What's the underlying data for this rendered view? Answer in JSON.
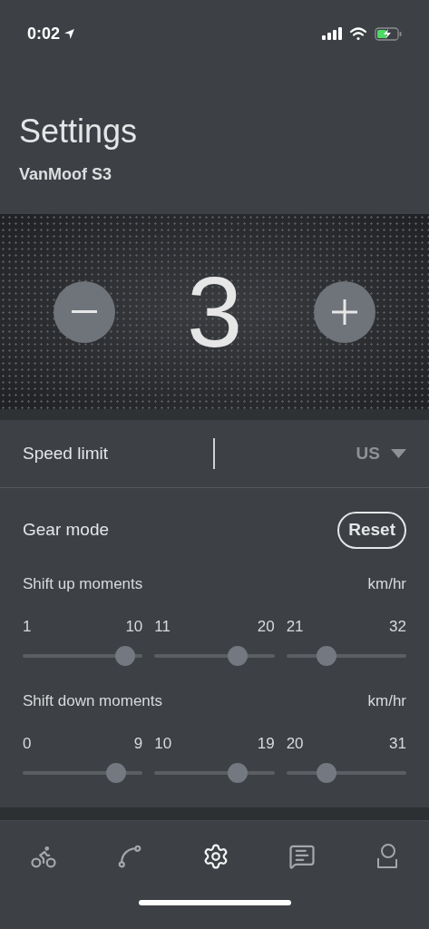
{
  "status_bar": {
    "time": "0:02"
  },
  "header": {
    "title": "Settings",
    "subtitle": "VanMoof S3"
  },
  "power_display": {
    "value": "3"
  },
  "speed_limit": {
    "label": "Speed limit",
    "region": "US"
  },
  "gear_mode": {
    "label": "Gear mode",
    "reset": "Reset",
    "groups": [
      {
        "label": "Shift up moments",
        "unit": "km/hr",
        "sliders": [
          {
            "min": "1",
            "max": "10",
            "level": 0.92
          },
          {
            "min": "11",
            "max": "20",
            "level": 0.73
          },
          {
            "min": "21",
            "max": "32",
            "level": 0.3
          }
        ]
      },
      {
        "label": "Shift down moments",
        "unit": "km/hr",
        "sliders": [
          {
            "min": "0",
            "max": "9",
            "level": 0.83
          },
          {
            "min": "10",
            "max": "19",
            "level": 0.73
          },
          {
            "min": "20",
            "max": "31",
            "level": 0.3
          }
        ]
      }
    ]
  },
  "tab_bar": [
    {
      "kind": "bike",
      "selected": false
    },
    {
      "kind": "route",
      "selected": false
    },
    {
      "kind": "settings",
      "selected": true
    },
    {
      "kind": "chat",
      "selected": false
    },
    {
      "kind": "account",
      "selected": false
    }
  ]
}
